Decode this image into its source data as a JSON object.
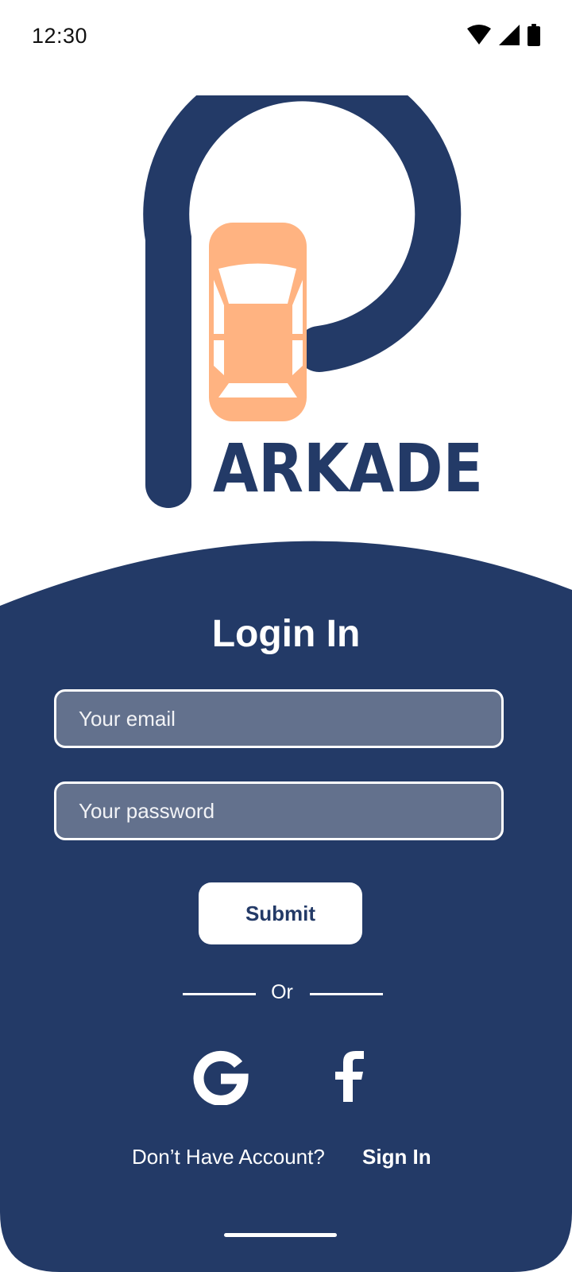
{
  "status_bar": {
    "time": "12:30",
    "icons": [
      "wifi-icon",
      "signal-icon",
      "battery-icon"
    ]
  },
  "logo": {
    "wordmark": "ARKADE",
    "primary_color": "#233a67",
    "accent_color": "#ffb381"
  },
  "login": {
    "title": "Login In",
    "email_placeholder": "Your email",
    "password_placeholder": "Your password",
    "submit_label": "Submit",
    "divider_text": "Or",
    "social": [
      "google-icon",
      "facebook-icon"
    ],
    "footer_prompt": "Don’t Have Account?",
    "footer_link": "Sign In"
  },
  "colors": {
    "panel": "#233a67",
    "field": "#63718d",
    "white": "#ffffff"
  }
}
